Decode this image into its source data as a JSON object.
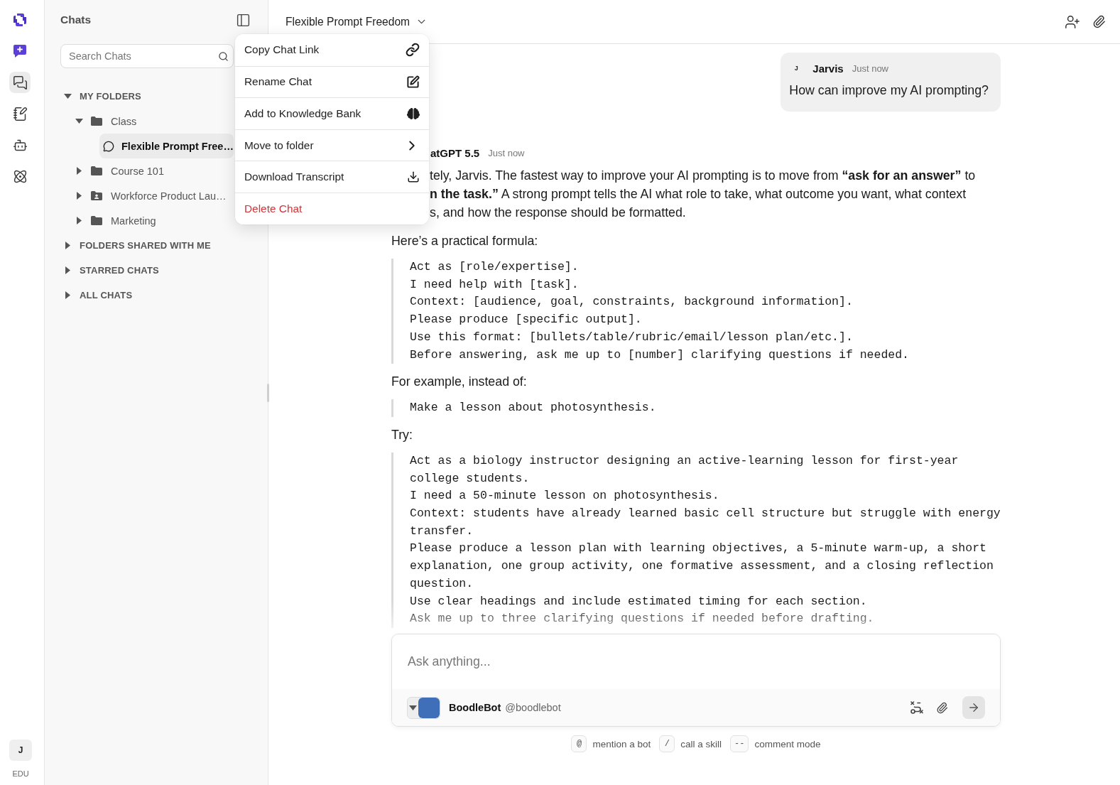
{
  "rail": {
    "items": [
      {
        "kind": "compose",
        "selected": false
      },
      {
        "kind": "chats",
        "selected": true
      },
      {
        "kind": "notes",
        "selected": false
      },
      {
        "kind": "bots",
        "selected": false
      },
      {
        "kind": "skills",
        "selected": false
      }
    ],
    "user": {
      "initial": "J",
      "plan": "EDU"
    }
  },
  "sidebar": {
    "title": "Chats",
    "search": {
      "placeholder": "Search Chats"
    },
    "sections": [
      {
        "label": "MY FOLDERS",
        "expanded": true,
        "children": [
          {
            "kind": "folder",
            "label": "Class",
            "expanded": true,
            "children": [
              {
                "kind": "chat",
                "label": "Flexible Prompt Free…",
                "selected": true
              }
            ]
          },
          {
            "kind": "folder",
            "label": "Course 101",
            "expanded": false
          },
          {
            "kind": "shared",
            "label": "Workforce Product Lau…",
            "expanded": false
          },
          {
            "kind": "folder",
            "label": "Marketing",
            "expanded": false
          }
        ]
      },
      {
        "label": "FOLDERS SHARED WITH ME",
        "expanded": false
      },
      {
        "label": "STARRED CHATS",
        "expanded": false
      },
      {
        "label": "ALL CHATS",
        "expanded": false
      }
    ]
  },
  "header": {
    "title": "Flexible Prompt Freedom"
  },
  "context_menu": {
    "items": [
      {
        "kind": "copy",
        "label": "Copy Chat Link"
      },
      {
        "kind": "rename",
        "label": "Rename Chat"
      },
      {
        "kind": "knowledge",
        "label": "Add to Knowledge Bank"
      },
      {
        "kind": "submenu",
        "label": "Move to folder"
      },
      {
        "kind": "download",
        "label": "Download Transcript"
      },
      {
        "kind": "danger",
        "label": "Delete Chat"
      }
    ]
  },
  "messages": [
    {
      "kind": "user",
      "avatar": "J",
      "author": "Jarvis",
      "time": "Just now",
      "text": "How can improve my AI prompting?"
    },
    {
      "kind": "assistant",
      "author": "atGPT 5.5",
      "time": "Just now",
      "blocks": [
        {
          "kind": "lines",
          "lines": [
            "tely, Jarvis. The fastest way to improve your AI prompting is to move from **“ask for an answer”** to",
            "**n the task.”** A strong prompt tells the AI what role to take, what outcome you want, what context",
            "s, and how the response should be formatted."
          ]
        },
        {
          "kind": "text",
          "text": "Here’s a practical formula:"
        },
        {
          "kind": "quote",
          "lines": [
            "Act as [role/expertise].",
            "I need help with [task].",
            "Context: [audience, goal, constraints, background information].",
            "Please produce [specific output].",
            "Use this format: [bullets/table/rubric/email/lesson plan/etc.].",
            "Before answering, ask me up to [number] clarifying questions if needed."
          ]
        },
        {
          "kind": "text",
          "text": "For example, instead of:"
        },
        {
          "kind": "quote",
          "lines": [
            "Make a lesson about photosynthesis."
          ]
        },
        {
          "kind": "text",
          "text": "Try:"
        },
        {
          "kind": "quote",
          "lines": [
            "Act as a biology instructor designing an active-learning lesson for first-year college students.",
            "I need a 50-minute lesson on photosynthesis.",
            "Context: students have already learned basic cell structure but struggle with energy transfer.",
            "Please produce a lesson plan with learning objectives, a 5-minute warm-up, a short explanation, one group activity, one formative assessment, and a closing reflection question.",
            "Use clear headings and include estimated timing for each section.",
            "Ask me up to three clarifying questions if needed before drafting."
          ]
        }
      ]
    }
  ],
  "composer": {
    "placeholder": "Ask anything...",
    "bot": {
      "name": "BoodleBot",
      "handle": "@boodlebot"
    }
  },
  "hints": [
    {
      "key": "@",
      "label": "mention a bot"
    },
    {
      "key": "/",
      "label": "call a skill"
    },
    {
      "key": "--",
      "label": "comment mode"
    }
  ]
}
